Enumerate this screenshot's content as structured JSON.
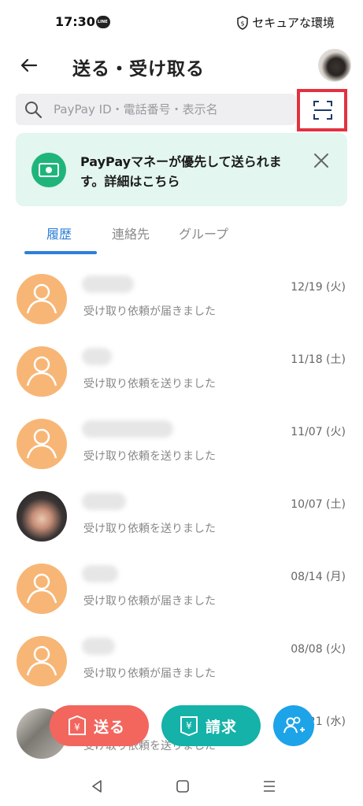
{
  "status_bar": {
    "time": "17:30",
    "secure_label": "セキュアな環境"
  },
  "header": {
    "title": "送る・受け取る"
  },
  "search": {
    "placeholder": "PayPay ID・電話番号・表示名"
  },
  "banner": {
    "text": "PayPayマネーが優先して送られます。詳細はこちら"
  },
  "tabs": [
    {
      "label": "履歴",
      "active": true
    },
    {
      "label": "連絡先",
      "active": false
    },
    {
      "label": "グループ",
      "active": false
    }
  ],
  "history": [
    {
      "date": "12/19 (火)",
      "status": "受け取り依頼が届きました",
      "avatar": "default"
    },
    {
      "date": "11/18 (土)",
      "status": "受け取り依頼を送りました",
      "avatar": "default"
    },
    {
      "date": "11/07 (火)",
      "status": "受け取り依頼を送りました",
      "avatar": "default"
    },
    {
      "date": "10/07 (土)",
      "status": "受け取り依頼を送りました",
      "avatar": "photo"
    },
    {
      "date": "08/14 (月)",
      "status": "受け取り依頼が届きました",
      "avatar": "default"
    },
    {
      "date": "08/08 (火)",
      "status": "受け取り依頼が届きました",
      "avatar": "default"
    },
    {
      "date": "21 (水)",
      "status": "受け取り依頼を送りました",
      "avatar": "photo2"
    }
  ],
  "actions": {
    "send_label": "送る",
    "request_label": "請求"
  },
  "colors": {
    "accent_blue": "#2d7fd8",
    "send_red": "#f2665e",
    "request_teal": "#14b2a8",
    "add_blue": "#1da3e8",
    "avatar_orange": "#f7b676",
    "banner_bg": "#e3f6ef",
    "highlight_red": "#e33140"
  },
  "icons": [
    "back-arrow-icon",
    "search-icon",
    "scan-qr-icon",
    "money-icon",
    "close-icon",
    "person-icon",
    "yen-card-icon",
    "add-friend-icon"
  ]
}
